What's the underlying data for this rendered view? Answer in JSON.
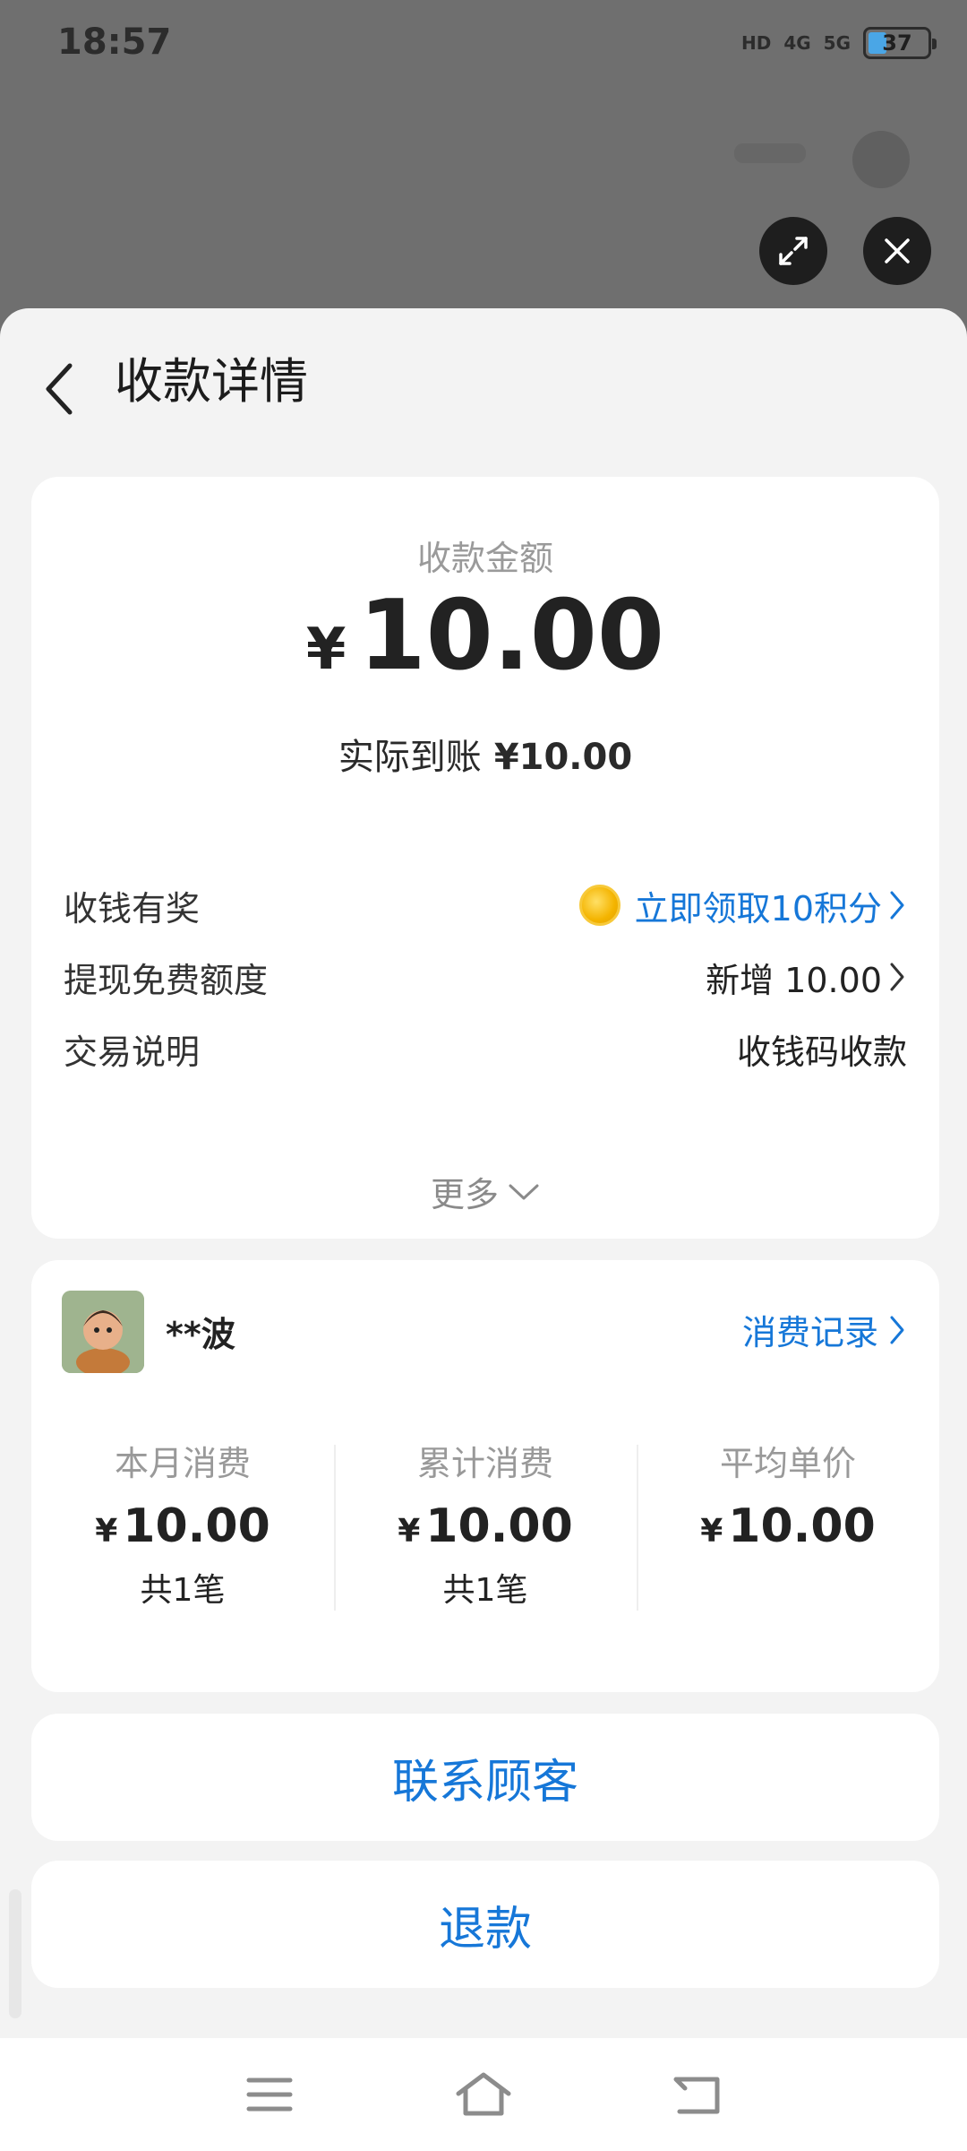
{
  "status_bar": {
    "time": "18:57",
    "hd_label": "HD",
    "signal_1": "4G",
    "signal_2": "5G",
    "battery": "37"
  },
  "header": {
    "title": "收款详情"
  },
  "amount_card": {
    "label": "收款金额",
    "currency": "¥",
    "amount": "10.00",
    "actual_label": "实际到账",
    "actual_amount": "¥10.00",
    "rows": [
      {
        "label": "收钱有奖",
        "value": "立即领取10积分"
      },
      {
        "label": "提现免费额度",
        "value": "新增 10.00"
      },
      {
        "label": "交易说明",
        "value": "收钱码收款"
      }
    ],
    "more": "更多"
  },
  "customer_card": {
    "name": "**波",
    "records_link": "消费记录",
    "stats": [
      {
        "label": "本月消费",
        "currency": "¥",
        "value": "10.00",
        "count": "共1笔"
      },
      {
        "label": "累计消费",
        "currency": "¥",
        "value": "10.00",
        "count": "共1笔"
      },
      {
        "label": "平均单价",
        "currency": "¥",
        "value": "10.00",
        "count": ""
      }
    ]
  },
  "actions": {
    "contact": "联系顾客",
    "refund": "退款"
  },
  "colors": {
    "accent": "#1677d8",
    "dim_background": "#6f6f6f",
    "sheet_background": "#f3f3f3"
  },
  "icons": [
    "back-chevron-icon",
    "expand-icon",
    "close-icon",
    "coin-icon",
    "chevron-right-icon",
    "chevron-down-icon",
    "menu-icon",
    "home-icon",
    "back-icon"
  ]
}
